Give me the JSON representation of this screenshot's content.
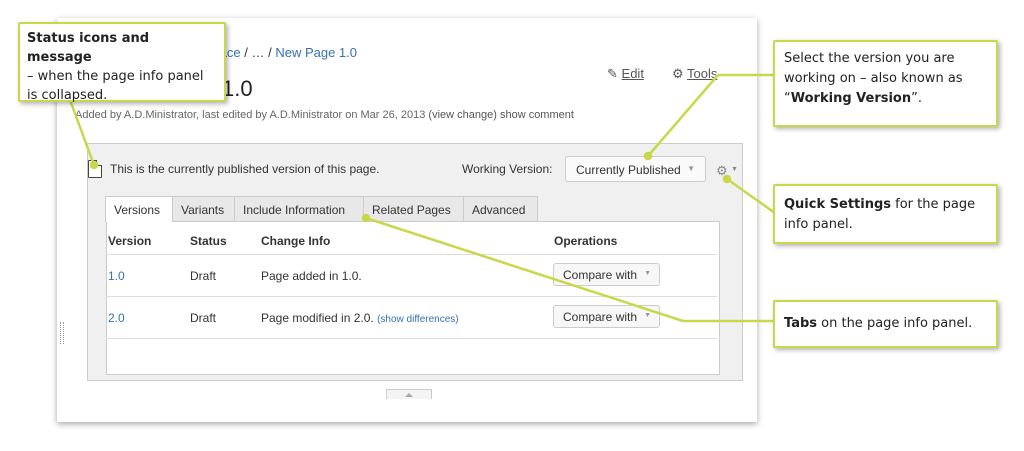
{
  "breadcrumb": {
    "space": "mple Space",
    "sep1": " / ",
    "ellipsis": "…",
    "sep2": " / ",
    "page": "New Page 1.0"
  },
  "page_title": "1.0",
  "meta": {
    "prefix": "Added by A.D.Ministrator, last edited by A.D.Ministrator on Mar 26, 2013",
    "view_change": "(view change)",
    "show_comment": "show comment"
  },
  "toolbar": {
    "edit_label": "Edit",
    "tools_label": "Tools"
  },
  "panel": {
    "status_message": "This is the currently published version of this page.",
    "working_version_label": "Working Version:",
    "working_version_value": "Currently Published",
    "tabs": [
      "Versions",
      "Variants",
      "Include Information",
      "Related Pages",
      "Advanced"
    ],
    "columns": [
      "Version",
      "Status",
      "Change Info",
      "Operations"
    ],
    "rows": [
      {
        "version": "1.0",
        "status": "Draft",
        "change_info": "Page added in 1.0.",
        "diff_link": "",
        "operation": "Compare with"
      },
      {
        "version": "2.0",
        "status": "Draft",
        "change_info": "Page modified in 2.0.",
        "diff_link": "(show differences)",
        "operation": "Compare with"
      }
    ]
  },
  "callouts": {
    "status": {
      "bold": "Status icons and message",
      "text": "– when the page info panel is collapsed."
    },
    "working": {
      "text1": "Select the version you are working on – also known as “",
      "bold": "Working Version",
      "text2": "”."
    },
    "quick": {
      "bold": "Quick Settings",
      "text": " for the page info panel."
    },
    "tabs": {
      "bold": "Tabs",
      "text": " on the page info panel."
    }
  },
  "icons": {
    "edit": "pencil-icon",
    "tools": "gear-icon",
    "page": "document-icon",
    "quick_settings": "gear-icon"
  },
  "colors": {
    "link": "#3572b0",
    "callout_border": "#c9d84a"
  }
}
